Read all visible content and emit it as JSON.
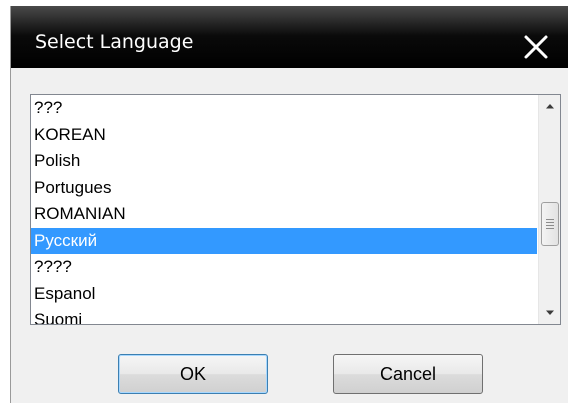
{
  "window": {
    "title": "Select Language"
  },
  "language_list": {
    "items": [
      {
        "label": "???",
        "selected": false
      },
      {
        "label": "KOREAN",
        "selected": false
      },
      {
        "label": "Polish",
        "selected": false
      },
      {
        "label": "Portugues",
        "selected": false
      },
      {
        "label": "ROMANIAN",
        "selected": false
      },
      {
        "label": "Русский",
        "selected": true
      },
      {
        "label": "????",
        "selected": false
      },
      {
        "label": "Espanol",
        "selected": false
      },
      {
        "label": "Suomi",
        "selected": false
      }
    ],
    "scroll_position": 0.6,
    "selection_color": "#3399ff"
  },
  "buttons": {
    "ok_label": "OK",
    "cancel_label": "Cancel"
  },
  "icons": {
    "close": "close-icon",
    "scroll_up": "chevron-up-icon",
    "scroll_down": "chevron-down-icon",
    "thumb_grip": "grip-icon"
  }
}
